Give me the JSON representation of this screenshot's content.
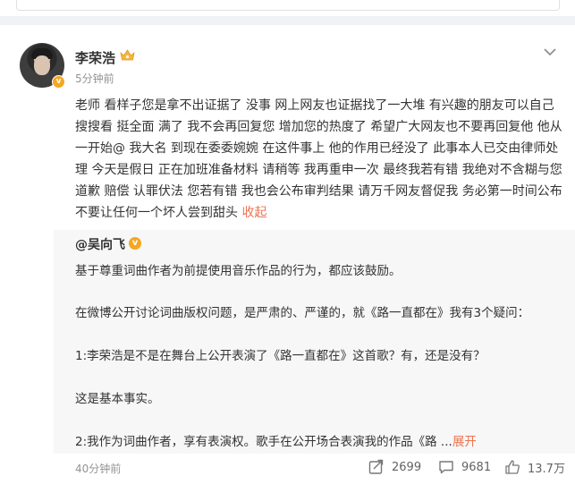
{
  "post": {
    "author": "李荣浩",
    "time": "5分钟前",
    "text": "老师 看样子您是拿不出证据了 没事 网上网友也证据找了一大堆 有兴趣的朋友可以自己搜搜看 挺全面 满了  我不会再回复您 增加您的热度了 希望广大网友也不要再回复他 他从一开始@ 我大名 到现在委委婉婉 在这件事上 他的作用已经没了  此事本人已交由律师处理 今天是假日 正在加班准备材料 请稍等    我再重申一次  最终我若有错 我绝对不含糊与您道歉 赔偿 认罪伏法 您若有错 我也会公布审判结果 请万千网友督促我 务必第一时间公布 不要让任何一个坏人尝到甜头 ",
    "collapse_label": "收起",
    "verified_badge": "v"
  },
  "repost": {
    "author": "@吴向飞",
    "verified_badge": "v",
    "lines": [
      "基于尊重词曲作者为前提使用音乐作品的行为，都应该鼓励。",
      "在微博公开讨论词曲版权问题，是严肃的、严谨的，就《路一直都在》我有3个疑问：",
      "1:李荣浩是不是在舞台上公开表演了《路一直都在》这首歌？有，还是没有？",
      "这是基本事实。",
      "2:我作为词曲作者，享有表演权。歌手在公开场合表演我的作品《路  ..."
    ],
    "expand_label": "展开",
    "time": "40分钟前",
    "reposts": "2699",
    "comments": "9681",
    "likes": "13.7万"
  },
  "icons": {
    "crown": "crown-badge-icon",
    "chevron": "chevron-down-icon",
    "repost": "repost-icon",
    "comment": "comment-icon",
    "like": "like-icon"
  },
  "colors": {
    "accent": "#eb7350",
    "verified": "#f5a623",
    "meta": "#939393"
  }
}
